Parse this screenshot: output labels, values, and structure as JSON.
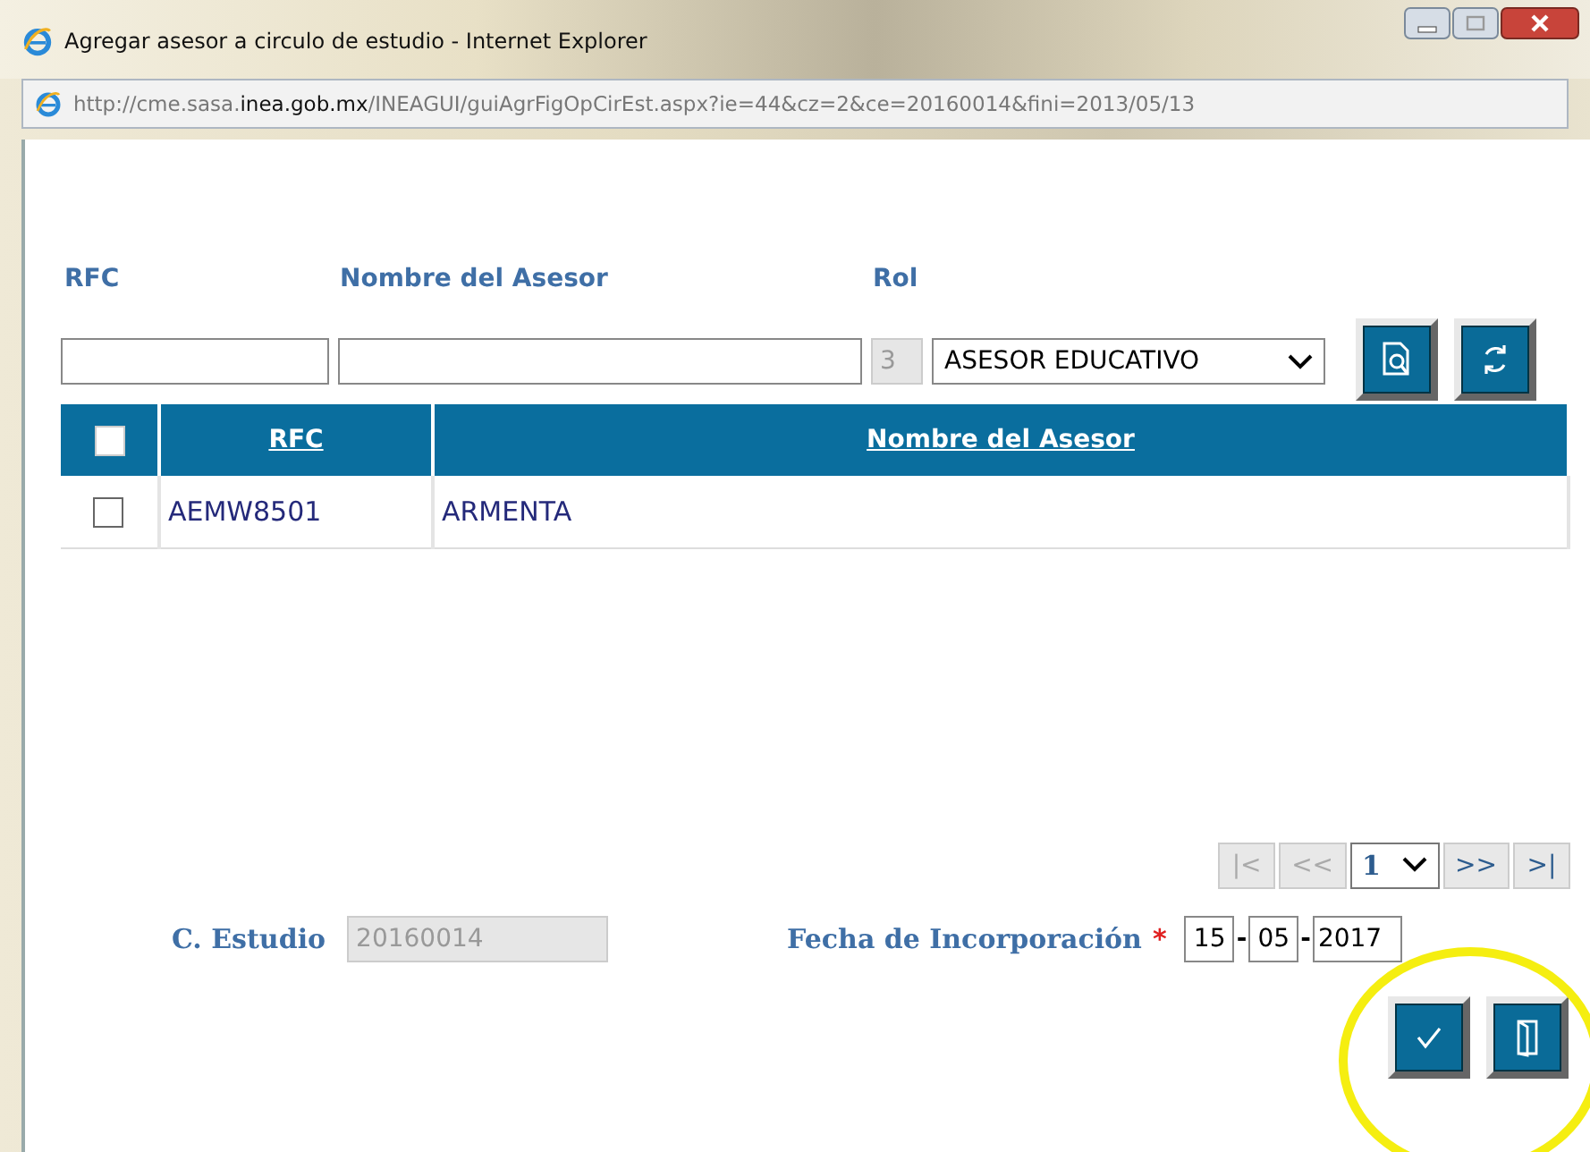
{
  "window": {
    "title": "Agregar asesor a circulo de estudio - Internet Explorer"
  },
  "address_bar": {
    "url": "http://cme.sasa.**inea.gob.mx**/INEAGUI/guiAgrFigOpCirEst.aspx?ie=44&cz=2&ce=20160014&fini=2013/05/13"
  },
  "filter_labels": [
    "RFC",
    "Nombre del Asesor",
    "Rol"
  ],
  "role": {
    "code": "3",
    "name": "ASESOR EDUCATIVO"
  },
  "table": {
    "header_checked": false,
    "columns": [
      "RFC",
      "Nombre del Asesor"
    ],
    "rows": [
      {
        "checked": false,
        "rfc": "AEMW8501",
        "name": "ARMENTA"
      }
    ]
  },
  "pager": {
    "buttons": [
      {
        "label": "|<",
        "disabled": true
      },
      {
        "label": "<<",
        "disabled": true
      },
      {
        "label": ">>",
        "disabled": false
      },
      {
        "label": ">|",
        "disabled": false
      }
    ],
    "page": "1"
  },
  "estudio": {
    "label": "C. Estudio",
    "value": "20160014"
  },
  "fecha": {
    "label": "Fecha de Incorporación",
    "required_mark": "*",
    "day": "15",
    "month": "05",
    "year": "2017",
    "separators": [
      "-",
      "-"
    ]
  }
}
